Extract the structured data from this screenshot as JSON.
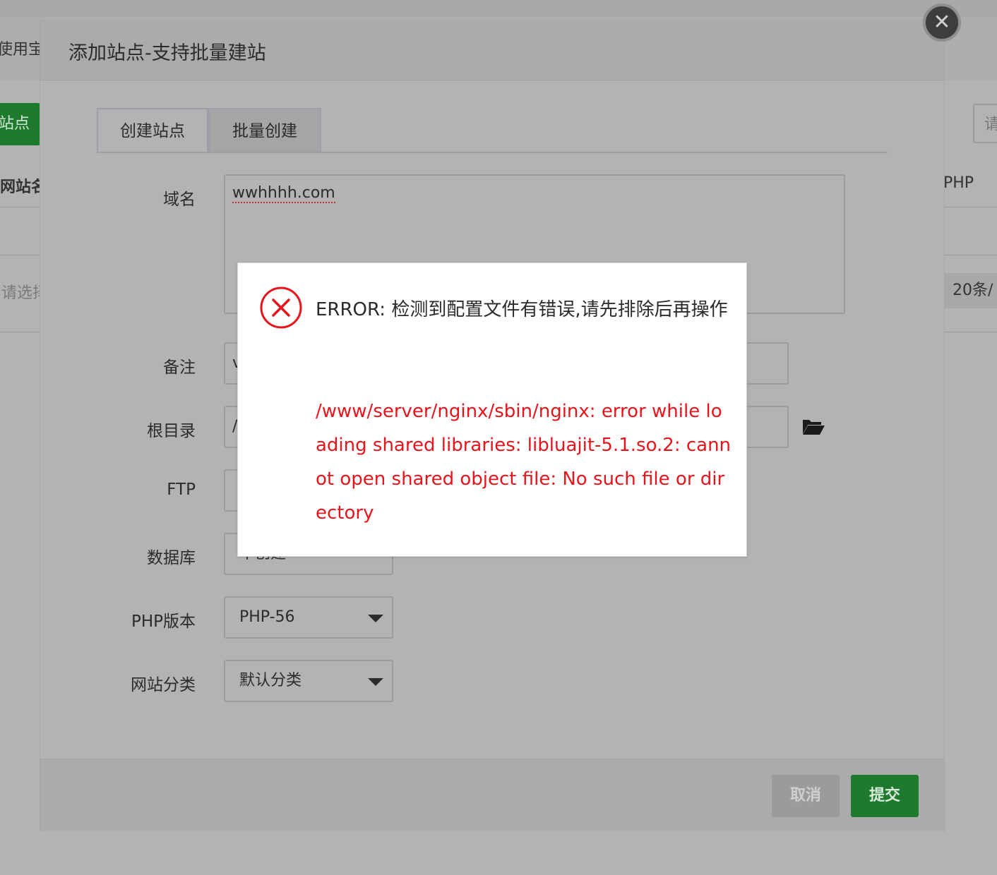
{
  "background": {
    "partial_text_left": "使用宝",
    "add_site_button": "站点",
    "col_site_name": "网站名",
    "col_php": "PHP",
    "select_placeholder": "请选择",
    "search_partial": "请",
    "page_size": "20条/"
  },
  "modal": {
    "title": "添加站点-支持批量建站",
    "close_icon": "close-icon",
    "tabs": [
      {
        "label": "创建站点",
        "active": true
      },
      {
        "label": "批量创建",
        "active": false
      }
    ],
    "form": {
      "domain": {
        "label": "域名",
        "value": "wwhhhh.com"
      },
      "remark": {
        "label": "备注",
        "value": "v"
      },
      "root_dir": {
        "label": "根目录",
        "value": "/"
      },
      "ftp": {
        "label": "FTP",
        "value": ""
      },
      "database": {
        "label": "数据库",
        "value": "不创建"
      },
      "php_version": {
        "label": "PHP版本",
        "value": "PHP-56"
      },
      "site_category": {
        "label": "网站分类",
        "value": "默认分类"
      }
    },
    "footer": {
      "cancel_label": "取消",
      "submit_label": "提交"
    }
  },
  "error_dialog": {
    "message": "ERROR: 检测到配置文件有错误,请先排除后再操作",
    "detail": "/www/server/nginx/sbin/nginx: error while loading shared libraries: libluajit-5.1.so.2: cannot open shared object file: No such file or directory",
    "icon": "error-circle-icon"
  },
  "colors": {
    "green": "#1f7a2f",
    "error_red": "#e8141c",
    "overlay_gray": "#b3b3b3"
  }
}
